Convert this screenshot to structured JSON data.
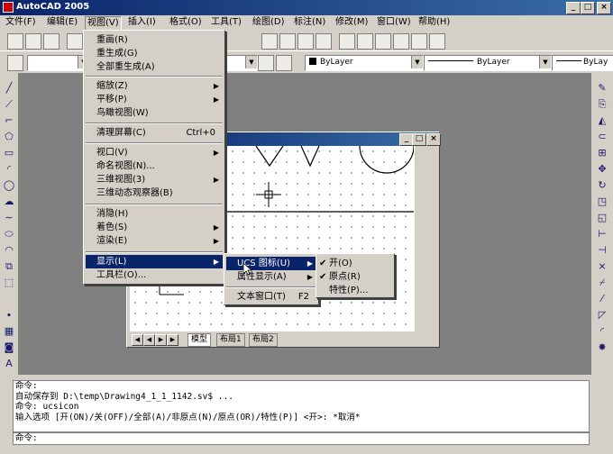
{
  "app": {
    "title": "AutoCAD 2005"
  },
  "menubar": {
    "items": [
      {
        "label": "文件(F)"
      },
      {
        "label": "编辑(E)"
      },
      {
        "label": "视图(V)"
      },
      {
        "label": "插入(I)"
      },
      {
        "label": "格式(O)"
      },
      {
        "label": "工具(T)"
      },
      {
        "label": "绘图(D)"
      },
      {
        "label": "标注(N)"
      },
      {
        "label": "修改(M)"
      },
      {
        "label": "窗口(W)"
      },
      {
        "label": "帮助(H)"
      }
    ]
  },
  "properties": {
    "color": "ByLayer",
    "linetype": "ByLayer",
    "lineweight": "ByLay"
  },
  "view_menu": {
    "items": [
      {
        "label": "重画(R)"
      },
      {
        "label": "重生成(G)"
      },
      {
        "label": "全部重生成(A)"
      },
      {
        "label": "缩放(Z)"
      },
      {
        "label": "平移(P)"
      },
      {
        "label": "鸟瞰视图(W)"
      },
      {
        "label": "清理屏幕(C)",
        "shortcut": "Ctrl+0"
      },
      {
        "label": "视口(V)"
      },
      {
        "label": "命名视图(N)..."
      },
      {
        "label": "三维视图(3)"
      },
      {
        "label": "三维动态观察器(B)"
      },
      {
        "label": "消隐(H)"
      },
      {
        "label": "着色(S)"
      },
      {
        "label": "渲染(E)"
      },
      {
        "label": "显示(L)"
      },
      {
        "label": "工具栏(O)..."
      }
    ]
  },
  "display_menu": {
    "items": [
      {
        "label": "UCS 图标(U)"
      },
      {
        "label": "属性显示(A)"
      },
      {
        "label": "文本窗口(T)",
        "shortcut": "F2"
      }
    ]
  },
  "ucs_menu": {
    "items": [
      {
        "label": "开(O)",
        "checked": true
      },
      {
        "label": "原点(R)",
        "checked": true
      },
      {
        "label": "特性(P)...",
        "checked": false
      }
    ]
  },
  "layout_tabs": [
    {
      "label": "模型"
    },
    {
      "label": "布局1"
    },
    {
      "label": "布局2"
    }
  ],
  "command": {
    "lines": [
      "命令:",
      "自动保存到 D:\\temp\\Drawing4_1_1_1142.sv$ ...",
      "命令: ucsicon",
      "输入选项 [开(ON)/关(OFF)/全部(A)/非原点(N)/原点(OR)/特性(P)] <开>: *取消*"
    ],
    "prompt": "命令:"
  },
  "window_controls": {
    "minimize": "_",
    "maximize": "□",
    "close": "×"
  },
  "colors": {
    "title_start": "#0a246a",
    "title_end": "#3a6ea5",
    "highlight": "#0a246a",
    "chrome": "#d4d0c8",
    "workspace": "#808080"
  }
}
